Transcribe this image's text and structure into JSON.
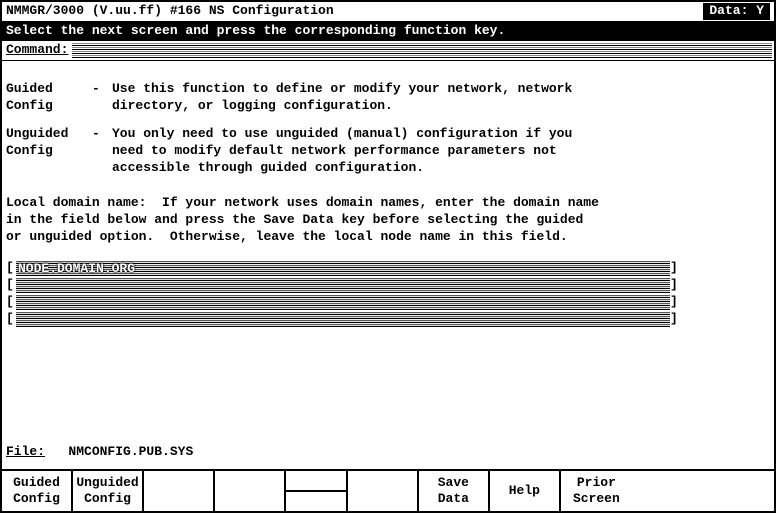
{
  "title": {
    "left": "NMMGR/3000 (V.uu.ff) #166  NS Configuration",
    "right_label": "Data:",
    "right_value": "Y"
  },
  "instruction": "Select the next screen and press the corresponding function key.",
  "command_label": "Command:",
  "sections": {
    "guided": {
      "label": "Guided\nConfig",
      "text": "Use this function to define or modify your network, network\ndirectory, or logging configuration."
    },
    "unguided": {
      "label": "Unguided\nConfig",
      "text": "You only need to use unguided (manual) configuration if you\nneed to modify default network performance parameters not\naccessible through guided configuration."
    }
  },
  "domain_text": "Local domain name:  If your network uses domain names, enter the domain name\nin the field below and press the Save Data key before selecting the guided\nor unguided option.  Otherwise, leave the local node name in this field.",
  "fields": {
    "line1": "NODE.DOMAIN.ORG",
    "line2": "",
    "line3": "",
    "line4": ""
  },
  "file": {
    "label": "File:",
    "value": "NMCONFIG.PUB.SYS"
  },
  "fkeys": {
    "f1a": "Guided",
    "f1b": "Config",
    "f2a": "Unguided",
    "f2b": "Config",
    "f3a": "",
    "f3b": "",
    "f4a": "",
    "f4b": "",
    "f5a": "",
    "f5b": "",
    "f6a": "Save",
    "f6b": "Data",
    "f7a": "Help",
    "f7b": "",
    "f8a": "Prior",
    "f8b": "Screen"
  }
}
